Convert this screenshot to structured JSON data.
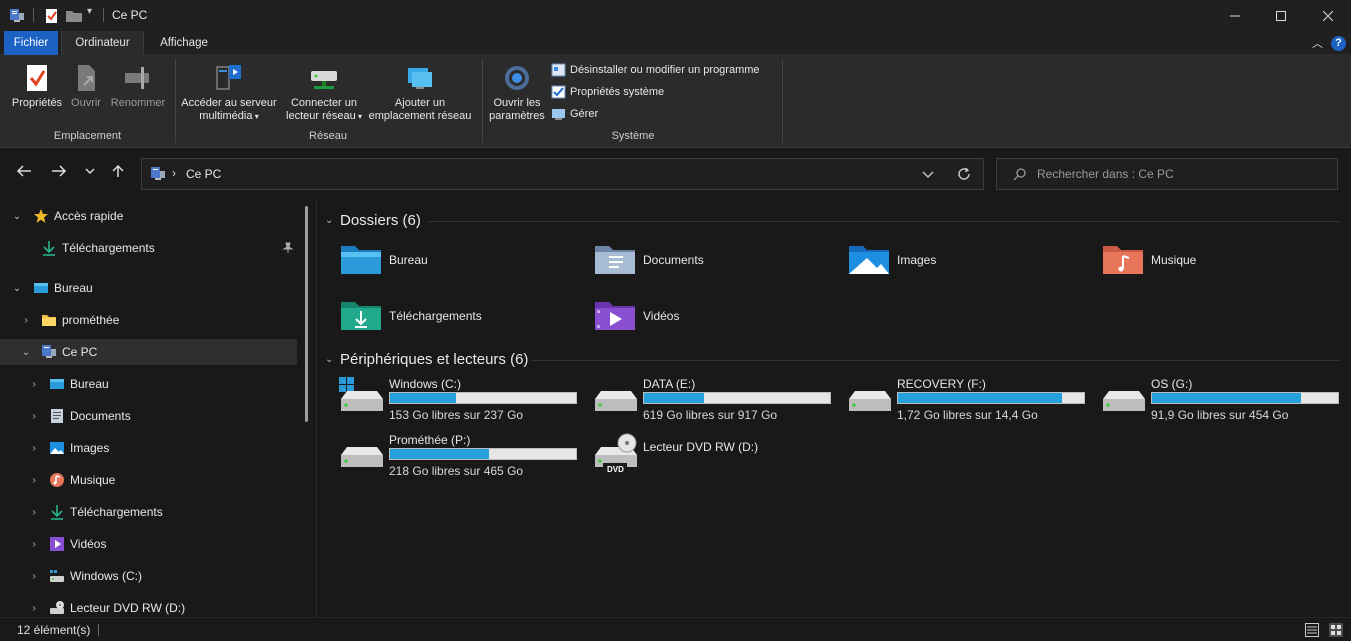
{
  "window": {
    "title": "Ce PC"
  },
  "ribbon_tabs": [
    "Fichier",
    "Ordinateur",
    "Affichage"
  ],
  "ribbon": {
    "location": {
      "props": "Propriétés",
      "open": "Ouvrir",
      "rename": "Renommer",
      "group": "Emplacement"
    },
    "network": {
      "media_1": "Accéder au serveur",
      "media_2": "multimédia",
      "map_1": "Connecter un",
      "map_2": "lecteur réseau",
      "add_1": "Ajouter un",
      "add_2": "emplacement réseau",
      "group": "Réseau"
    },
    "system": {
      "settings_1": "Ouvrir les",
      "settings_2": "paramètres",
      "uninstall": "Désinstaller ou modifier un programme",
      "sysprops": "Propriétés système",
      "manage": "Gérer",
      "group": "Système"
    }
  },
  "address": {
    "path": "Ce PC"
  },
  "search": {
    "placeholder": "Rechercher dans : Ce PC"
  },
  "sidebar": {
    "items": [
      {
        "label": "Accès rapide",
        "icon": "star-icon"
      },
      {
        "label": "Téléchargements",
        "icon": "download-icon"
      },
      {
        "label": "Bureau",
        "icon": "desktop-icon"
      },
      {
        "label": "prométhée",
        "icon": "folder-icon"
      },
      {
        "label": "Ce PC",
        "icon": "this-pc-icon"
      },
      {
        "label": "Bureau",
        "icon": "desktop-icon"
      },
      {
        "label": "Documents",
        "icon": "documents-icon"
      },
      {
        "label": "Images",
        "icon": "images-icon"
      },
      {
        "label": "Musique",
        "icon": "music-icon"
      },
      {
        "label": "Téléchargements",
        "icon": "download-icon"
      },
      {
        "label": "Vidéos",
        "icon": "videos-icon"
      },
      {
        "label": "Windows (C:)",
        "icon": "drive-icon"
      },
      {
        "label": "Lecteur DVD RW (D:)",
        "icon": "dvd-icon"
      }
    ]
  },
  "content": {
    "folders_header": "Dossiers (6)",
    "folders": [
      {
        "label": "Bureau",
        "color": "#2a9bd8"
      },
      {
        "label": "Documents",
        "color": "#8aa4c2"
      },
      {
        "label": "Images",
        "color": "#1e8fe0"
      },
      {
        "label": "Musique",
        "color": "#e8765a"
      },
      {
        "label": "Téléchargements",
        "color": "#20a98c"
      },
      {
        "label": "Vidéos",
        "color": "#8a4fd0"
      }
    ],
    "devices_header": "Périphériques et lecteurs (6)",
    "drives": [
      {
        "name": "Windows (C:)",
        "free": "153 Go libres sur 237 Go",
        "used_fraction": 0.355
      },
      {
        "name": "DATA (E:)",
        "free": "619 Go libres sur 917 Go",
        "used_fraction": 0.325
      },
      {
        "name": "RECOVERY (F:)",
        "free": "1,72 Go libres sur 14,4 Go",
        "used_fraction": 0.88
      },
      {
        "name": "OS (G:)",
        "free": "91,9 Go libres sur 454 Go",
        "used_fraction": 0.8
      },
      {
        "name": "Prométhée (P:)",
        "free": "218 Go libres sur 465 Go",
        "used_fraction": 0.53
      }
    ],
    "dvd": {
      "name": "Lecteur DVD RW (D:)",
      "badge": "DVD"
    }
  },
  "status": {
    "count": "12 élément(s)"
  },
  "colors": {
    "accent": "#1b62c4",
    "drive_fill": "#26a0da"
  }
}
